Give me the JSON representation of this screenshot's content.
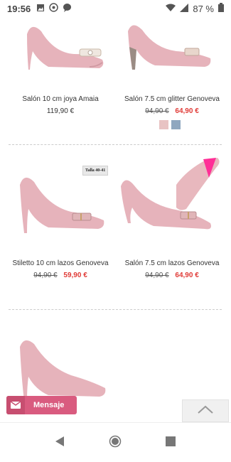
{
  "status_bar": {
    "time": "19:56",
    "battery": "87 %",
    "icons": [
      "image-icon",
      "whatsapp-icon",
      "chat-icon",
      "wifi-icon",
      "signal-icon",
      "battery-icon"
    ]
  },
  "products": [
    {
      "name": "Salón 10 cm joya Amaia",
      "price": "119,90 €"
    },
    {
      "name": "Salón 7.5 cm glitter Genoveva",
      "old_price": "94,90 €",
      "new_price": "64,90 €",
      "swatch_colors": [
        "#e8c3c3",
        "#8fa7bf"
      ]
    },
    {
      "name": "Stiletto 10 cm lazos Genoveva",
      "old_price": "94,90 €",
      "new_price": "59,90 €",
      "badge": "Talla 40-41"
    },
    {
      "name": "Salón 7.5 cm lazos Genoveva",
      "old_price": "94,90 €",
      "new_price": "64,90 €"
    }
  ],
  "message_button": {
    "label": "Mensaje"
  },
  "colors": {
    "shoe_pink": "#e6b3bb",
    "sale_red": "#e03a36",
    "message_pink": "#d95b7f"
  }
}
